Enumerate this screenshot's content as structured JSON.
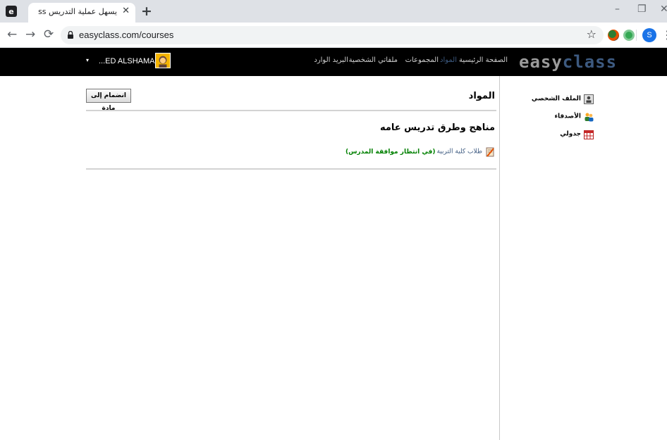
{
  "browser": {
    "tab_title": "يسهل عملية التدريس Easyclass",
    "tab_close": "✕",
    "new_tab": "+",
    "url": "easyclass.com/courses",
    "profile_initial": "S",
    "window_controls": {
      "minimize": "–",
      "restore": "❐",
      "close": "✕"
    }
  },
  "header": {
    "logo_part1": "easy",
    "logo_part2": "class",
    "nav": {
      "home": "الصفحة الرئيسية",
      "courses": "المواد",
      "groups": "المجموعات",
      "files": "ملفاتي الشخصية",
      "inbox": "البريد الوارد"
    },
    "user_name": "...ED ALSHAMARI",
    "user_caret": "▾"
  },
  "sidebar": {
    "items": [
      {
        "label": "الملف الشخصي",
        "icon": "profile-icon"
      },
      {
        "label": "الأصدقاء",
        "icon": "friends-icon"
      },
      {
        "label": "جدولي",
        "icon": "calendar-icon"
      }
    ]
  },
  "main": {
    "title": "المواد",
    "join_button": "انضمام إلى مادة",
    "course": {
      "title": "مناهج وطرق تدريس عامه",
      "audience": "طلاب كلية التربية",
      "status": "(في انتظار موافقة المدرس)"
    }
  },
  "colors": {
    "header_bg": "#000000",
    "logo_accent": "#3d5a80",
    "status_green": "#008000"
  }
}
